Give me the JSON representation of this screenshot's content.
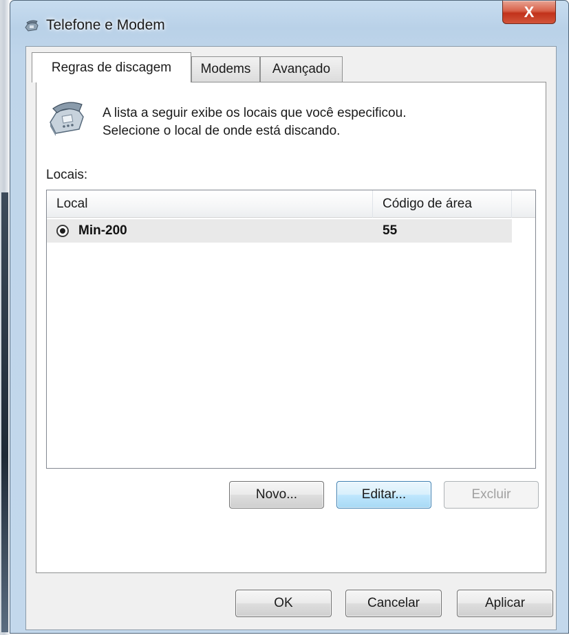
{
  "window": {
    "title": "Telefone e Modem",
    "close_label": "X"
  },
  "tabs": [
    {
      "label": "Regras de discagem",
      "active": true
    },
    {
      "label": "Modems",
      "active": false
    },
    {
      "label": "Avançado",
      "active": false
    }
  ],
  "panel": {
    "intro_line1": "A lista a seguir exibe os locais que você especificou.",
    "intro_line2": "Selecione o local de onde está discando.",
    "locations_label": "Locais:"
  },
  "list": {
    "columns": [
      "Local",
      "Código de área"
    ],
    "rows": [
      {
        "local": "Min-200",
        "area_code": "55",
        "selected": true
      }
    ]
  },
  "list_buttons": {
    "new": "Novo...",
    "edit": "Editar...",
    "delete": "Excluir"
  },
  "dialog_buttons": {
    "ok": "OK",
    "cancel": "Cancelar",
    "apply": "Aplicar"
  },
  "colors": {
    "frame": "#bfd5ea",
    "close_button": "#c1321b",
    "default_button_border": "#3c7fb1"
  },
  "icons": {
    "title": "telephone-icon",
    "intro": "telephone-icon",
    "row": "radio-selected-icon"
  }
}
